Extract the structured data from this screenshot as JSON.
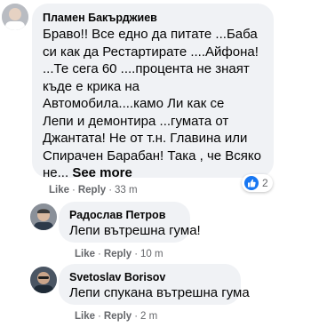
{
  "comments": [
    {
      "author": "Пламен Бакърджиев",
      "text_lines": [
        "Браво!! Все едно да питате ...Баба",
        "си как да Рестартирате ....Айфона!",
        "...Те сега 60 ....процента не знаят",
        "къде е крика на",
        "Автомобила....камо Ли как се",
        "Лепи и демонтира ...гумата от",
        "Джантата! Не от т.н. Главина или",
        "Спирачен Барабан! Така , че Всяко"
      ],
      "last_line": "не...",
      "see_more": "See more",
      "like": "Like",
      "reply": "Reply",
      "time": "33 m",
      "reaction_count": "2",
      "reaction_icon": "like-icon",
      "reaction_color": "#1877f2"
    },
    {
      "author": "Радослав Петров",
      "text": "Лепи вътрешна гума!",
      "like": "Like",
      "reply": "Reply",
      "time": "10 m"
    },
    {
      "author": "Svetoslav Borisov",
      "text": "Лепи спукана вътрешна гума",
      "like": "Like",
      "reply": "Reply",
      "time": "2 m"
    }
  ],
  "separator": "·"
}
